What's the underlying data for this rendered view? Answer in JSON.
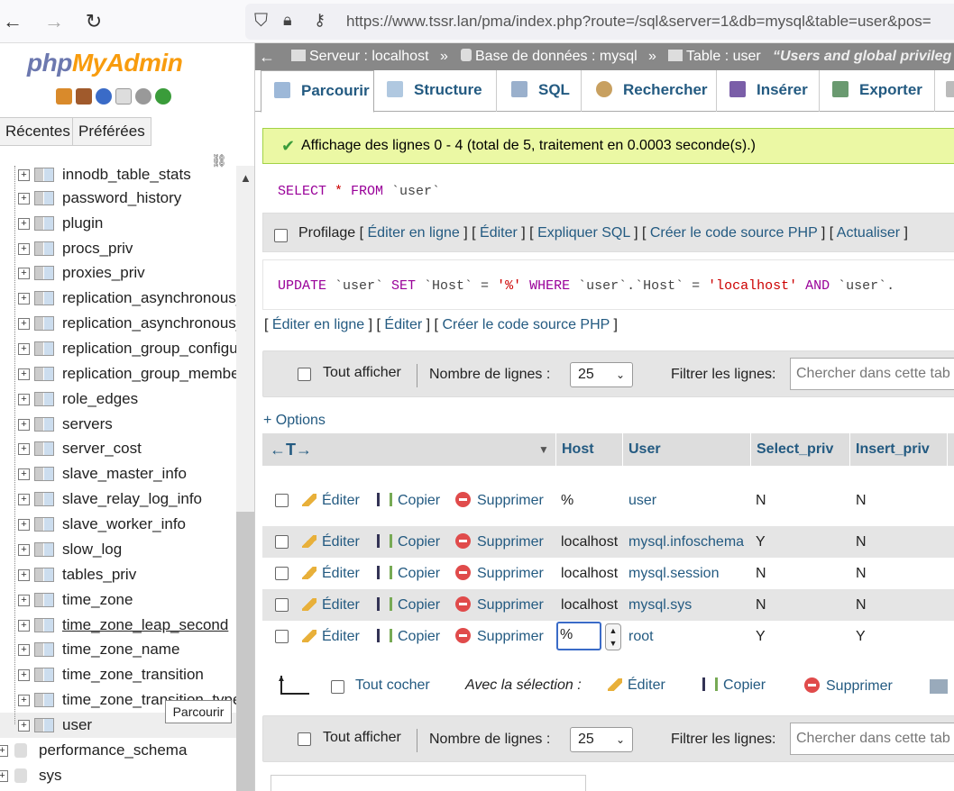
{
  "browser": {
    "url": "https://www.tssr.lan/pma/index.php?route=/sql&server=1&db=mysql&table=user&pos="
  },
  "sidebar": {
    "logo_a": "php",
    "logo_b": "MyAdmin",
    "recent_label": "Récentes",
    "favorites_label": "Préférées",
    "tables": [
      "innodb_table_stats",
      "password_history",
      "plugin",
      "procs_priv",
      "proxies_priv",
      "replication_asynchronous_",
      "replication_asynchronous_",
      "replication_group_configur",
      "replication_group_member",
      "role_edges",
      "servers",
      "server_cost",
      "slave_master_info",
      "slave_relay_log_info",
      "slave_worker_info",
      "slow_log",
      "tables_priv",
      "time_zone",
      "time_zone_leap_second",
      "time_zone_name",
      "time_zone_transition",
      "time_zone_transition_type",
      "user"
    ],
    "databases": [
      "performance_schema",
      "sys"
    ],
    "tooltip": "Parcourir"
  },
  "breadcrumb": {
    "server": "Serveur : localhost",
    "database": "Base de données : mysql",
    "table": "Table : user",
    "comment": "“Users and global privileg"
  },
  "tabs": [
    "Parcourir",
    "Structure",
    "SQL",
    "Rechercher",
    "Insérer",
    "Exporter"
  ],
  "message": "Affichage des lignes 0 - 4 (total de 5, traitement en 0.0003 seconde(s).)",
  "query": {
    "select_kw": "SELECT",
    "star": " * ",
    "from_kw": "FROM",
    "table": " `user`",
    "profiling": "Profilage",
    "links": [
      "Éditer en ligne",
      "Éditer",
      "Expliquer SQL",
      "Créer le code source PHP",
      "Actualiser"
    ]
  },
  "update_query": {
    "update_kw": "UPDATE",
    "t1": " `user` ",
    "set_kw": "SET",
    "t2": " `Host` = ",
    "v1": "'%'",
    "t3": " WHERE ",
    "t4": "`user`.`Host` = ",
    "v2": "'localhost'",
    "t5": " AND ",
    "t6": "`user`.",
    "links": [
      "Éditer en ligne",
      "Éditer",
      "Créer le code source PHP"
    ]
  },
  "nav": {
    "show_all": "Tout afficher",
    "rows_label": "Nombre de lignes :",
    "rows_value": "25",
    "filter_label": "Filtrer les lignes:",
    "filter_placeholder": "Chercher dans cette tab"
  },
  "options_label": "+ Options",
  "table": {
    "columns": [
      "Host",
      "User",
      "Select_priv",
      "Insert_priv"
    ],
    "action_edit": "Éditer",
    "action_copy": "Copier",
    "action_delete": "Supprimer",
    "rows": [
      {
        "host": "%",
        "user": "user",
        "select": "N",
        "insert": "N"
      },
      {
        "host": "localhost",
        "user": "mysql.infoschema",
        "select": "Y",
        "insert": "N"
      },
      {
        "host": "localhost",
        "user": "mysql.session",
        "select": "N",
        "insert": "N"
      },
      {
        "host": "localhost",
        "user": "mysql.sys",
        "select": "N",
        "insert": "N"
      },
      {
        "host": "%",
        "user": "root",
        "select": "Y",
        "insert": "Y"
      }
    ]
  },
  "bulk": {
    "check_all": "Tout cocher",
    "with_selection": "Avec la sélection :",
    "edit": "Éditer",
    "copy": "Copier",
    "delete": "Supprimer"
  },
  "colors": {
    "link": "#235a81",
    "success_bg": "#ebf8a4",
    "header_bar": "#888888"
  }
}
